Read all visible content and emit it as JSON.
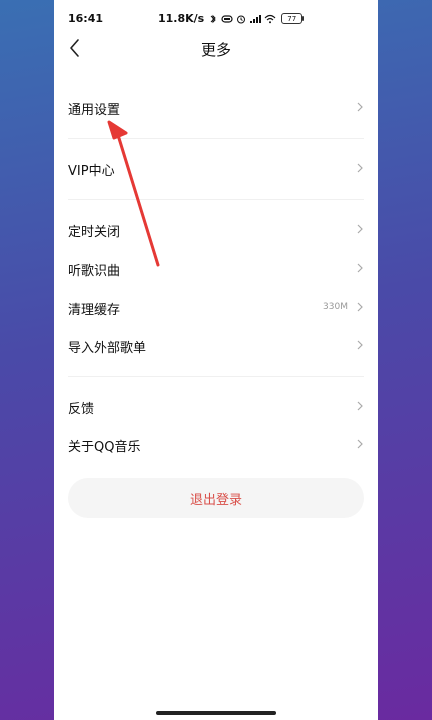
{
  "status_bar": {
    "time": "16:41",
    "net_speed": "11.8K/s",
    "battery": "77"
  },
  "header": {
    "title": "更多"
  },
  "menu": {
    "general_settings": "通用设置",
    "vip_center": "VIP中心",
    "sleep_timer": "定时关闭",
    "song_recognition": "听歌识曲",
    "clear_cache": "清理缓存",
    "cache_size": "330M",
    "import_playlist": "导入外部歌单",
    "feedback": "反馈",
    "about": "关于QQ音乐"
  },
  "logout_label": "退出登录",
  "colors": {
    "annotation_arrow": "#e53935",
    "logout_text": "#d9504a"
  }
}
